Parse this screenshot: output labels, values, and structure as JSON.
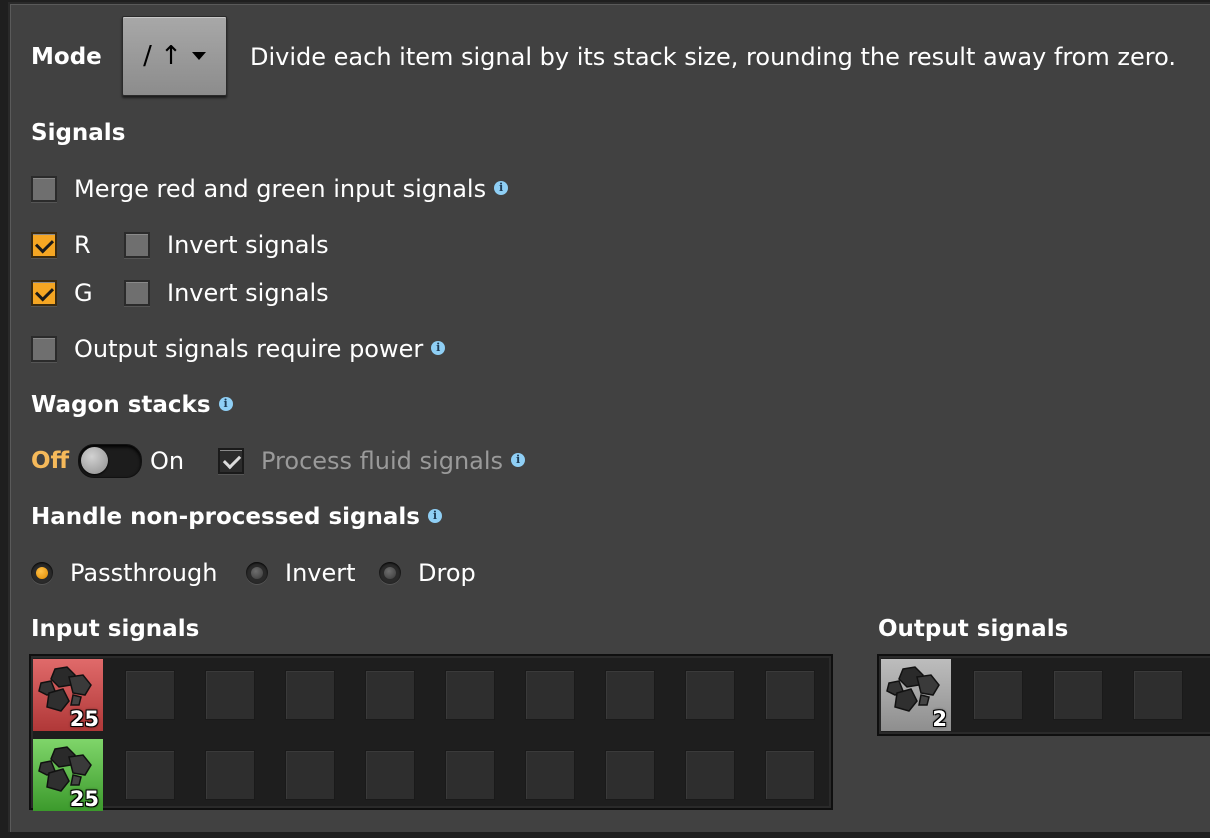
{
  "mode": {
    "label": "Mode",
    "selected": "/ ↑",
    "description": "Divide each item signal by its stack size, rounding the result away from zero."
  },
  "signals": {
    "heading": "Signals",
    "merge_label": "Merge red and green input signals",
    "merge_checked": false,
    "red_label": "R",
    "red_checked": true,
    "green_label": "G",
    "green_checked": true,
    "invert_label": "Invert signals",
    "output_power_label": "Output signals require power"
  },
  "wagon": {
    "heading": "Wagon stacks",
    "off_label": "Off",
    "on_label": "On",
    "toggle_state": "off",
    "fluid_label": "Process fluid signals",
    "fluid_checked": true
  },
  "non_processed": {
    "heading": "Handle non-processed signals",
    "options": [
      "Passthrough",
      "Invert",
      "Drop"
    ],
    "selected": "Passthrough"
  },
  "input_signals": {
    "heading": "Input signals",
    "red_row": [
      {
        "item": "coal-icon",
        "count": "25"
      }
    ],
    "green_row": [
      {
        "item": "coal-icon",
        "count": "25"
      }
    ]
  },
  "output_signals": {
    "heading": "Output signals",
    "row": [
      {
        "item": "coal-icon",
        "count": "2"
      }
    ]
  },
  "colors": {
    "panel": "#414141",
    "accent_orange": "#f5a623",
    "info_blue": "#8fcff5",
    "red_wire": "#c94a4a",
    "green_wire": "#52b03d"
  }
}
